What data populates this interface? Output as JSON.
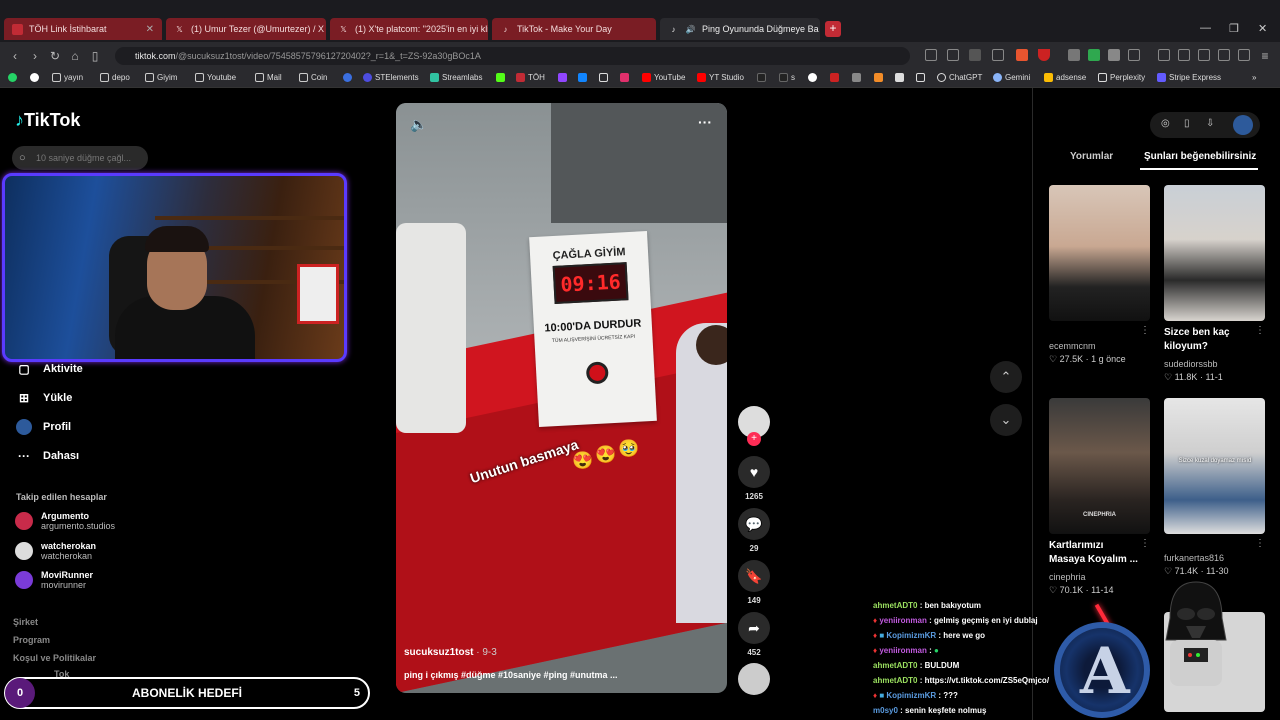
{
  "browser": {
    "tabs": [
      {
        "title": "TÖH Link İstihbarat",
        "style": "red"
      },
      {
        "title": "(1) Umur Tezer (@Umurtezer) / X",
        "style": "red"
      },
      {
        "title": "(1) X'te platcom: \"2025'in en iyi klibi",
        "style": "red"
      },
      {
        "title": "TikTok - Make Your Day",
        "style": "red"
      },
      {
        "title": "Ping Oyununda Düğmeye Ba",
        "style": "active"
      }
    ],
    "new_tab_label": "+",
    "url_domain": "tiktok.com",
    "url_path": "/@sucuksuz1tost/video/7545857579612720402?_r=1&_t=ZS-92a30gBOc1A",
    "bookmarks": [
      "yayın",
      "depo",
      "Giyim",
      "Youtube",
      "Mail",
      "Coin",
      "STElements",
      "Streamlabs",
      "TÖH",
      "YouTube",
      "YT Studio",
      "s",
      "ChatGPT",
      "Gemini",
      "adsense",
      "Perplexity",
      "Stripe Express"
    ]
  },
  "sidebar": {
    "logo": "TikTok",
    "search_placeholder": "10 saniye düğme çağl...",
    "nav": [
      {
        "label": "Aktivite",
        "icon": "bell-icon"
      },
      {
        "label": "Yükle",
        "icon": "plus-box-icon"
      },
      {
        "label": "Profil",
        "icon": "avatar-icon"
      },
      {
        "label": "Dahası",
        "icon": "more-icon"
      }
    ],
    "following_title": "Takip edilen hesaplar",
    "following": [
      {
        "name": "Argumento",
        "handle": "argumento.studios"
      },
      {
        "name": "watcherokan",
        "handle": "watcherokan"
      },
      {
        "name": "MoviRunner",
        "handle": "movirunner"
      }
    ],
    "footer": [
      "Şirket",
      "Program",
      "Koşul ve Politikalar"
    ],
    "footer_partial": "Tok"
  },
  "stream_overlay": {
    "goal_title": "ABONELİK HEDEFİ",
    "goal_current": "0",
    "goal_target": "5"
  },
  "video": {
    "sign_brand": "ÇAĞLA GİYİM",
    "sign_timer": "09:16",
    "sign_headline": "10:00'DA DURDUR",
    "sign_subline": "TÜM ALIŞVERİŞİNİ ÜCRETSİZ KAPI",
    "overlay_text": "Unutun basmaya",
    "author": "sucuksuz1tost",
    "date": "· 9-3",
    "caption": "ping i çıkmış #düğme #10saniye #ping #unutma ..."
  },
  "actions": {
    "likes": "1265",
    "comments": "29",
    "saves": "149",
    "shares": "452"
  },
  "right_panel": {
    "tabs": [
      "Yorumlar",
      "Şunları beğenebilirsiniz"
    ],
    "active_tab": "Şunları beğenebilirsiniz",
    "videos": [
      {
        "title": "",
        "user": "ecemmcnm",
        "likes": "27.5K",
        "date": "1 g önce"
      },
      {
        "title": "Sizce ben kaç kiloyum?",
        "user": "sudediorssbb",
        "likes": "11.8K",
        "date": "11-1"
      },
      {
        "title": "Kartlarımızı Masaya Koyalım ...",
        "user": "cinephria",
        "likes": "70.1K",
        "date": "11-14",
        "thumb_text": "CINEPHRIA"
      },
      {
        "title": "",
        "user": "furkanertas816",
        "likes": "71.4K",
        "date": "11-30",
        "thumb_text": "Sizce kuzal doyamaz mısıd"
      }
    ]
  },
  "chat": [
    {
      "user": "ahmetADT0",
      "message": ": ben bakıyotum",
      "color": "u"
    },
    {
      "user": "yeniironman",
      "message": ": gelmiş geçmiş en iyi dublaj",
      "color": "u2"
    },
    {
      "user": "KopimizmKR",
      "message": ": here we go",
      "color": "u3"
    },
    {
      "user": "yeniironman",
      "message": ":",
      "color": "u2"
    },
    {
      "user": "ahmetADT0",
      "message": ": BULDUM",
      "color": "u"
    },
    {
      "user": "ahmetADT0",
      "message": ": https://vt.tiktok.com/ZS5eQmjco/",
      "color": "u"
    },
    {
      "user": "KopimizmKR",
      "message": ": ???",
      "color": "u3"
    },
    {
      "user": "m0sy0",
      "message": ": senin keşfete nolmuş",
      "color": "u3"
    }
  ]
}
